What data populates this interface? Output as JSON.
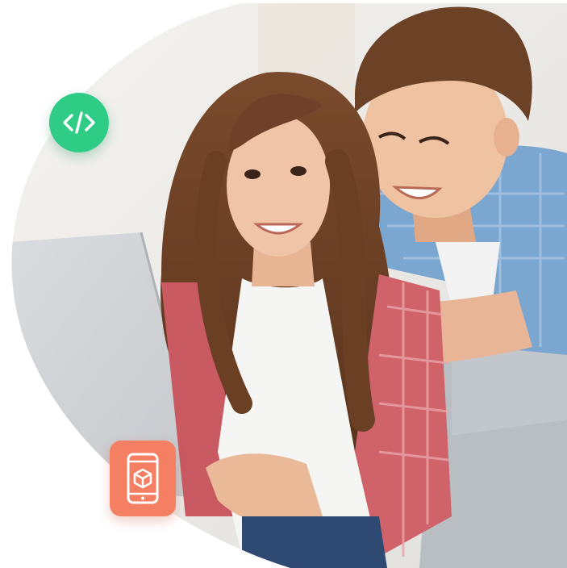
{
  "scene": {
    "description_visible": false,
    "colors": {
      "background": "#ffffff",
      "wall": "#eceae6",
      "couch": "#b9bec3",
      "laptop": "#d4d7da",
      "code_badge": "#2ecc85",
      "app_badge": "#f47f62"
    }
  },
  "badges": {
    "code": {
      "icon": "code-brackets-icon",
      "color": "#2ecc85"
    },
    "app": {
      "icon": "mobile-cube-icon",
      "color": "#f47f62"
    }
  }
}
